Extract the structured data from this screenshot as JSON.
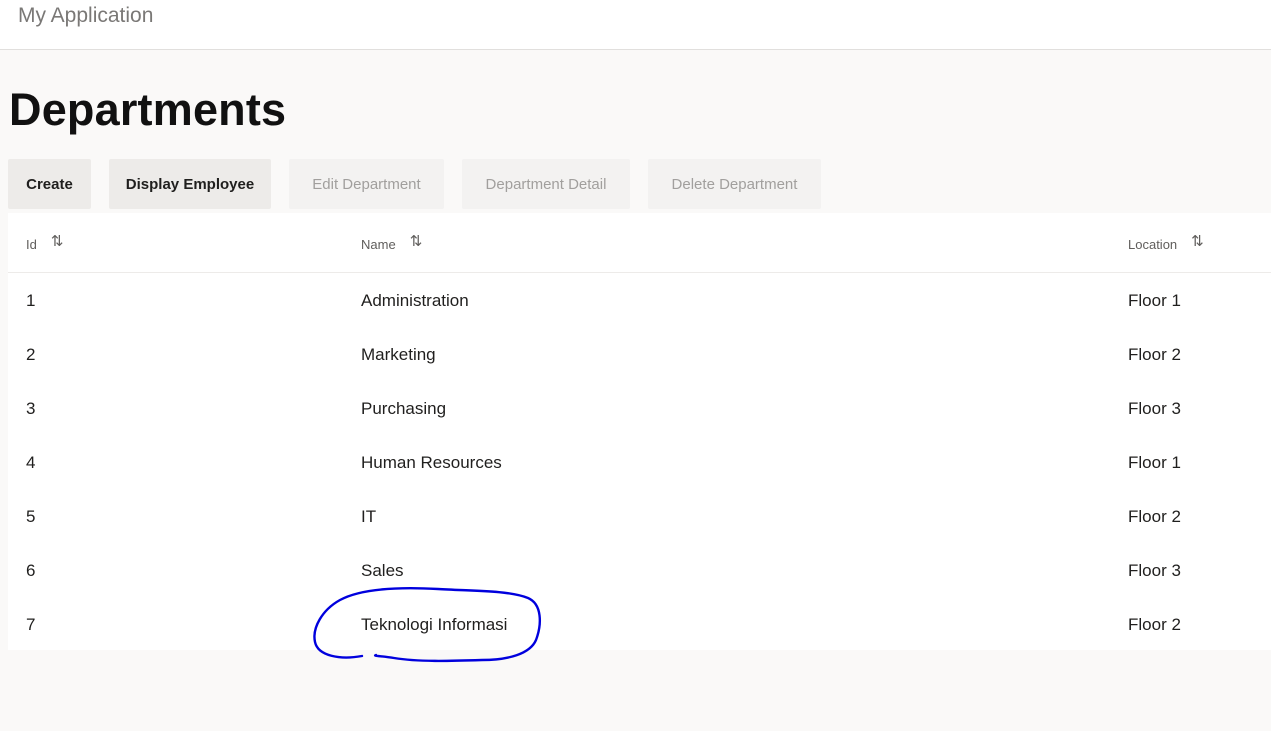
{
  "app": {
    "title": "My Application"
  },
  "page": {
    "title": "Departments"
  },
  "toolbar": {
    "create_label": "Create",
    "display_employee_label": "Display Employee",
    "edit_department_label": "Edit Department",
    "department_detail_label": "Department Detail",
    "delete_department_label": "Delete Department"
  },
  "table": {
    "columns": [
      {
        "label": "Id",
        "sort_icon": "sort-icon"
      },
      {
        "label": "Name",
        "sort_icon": "sort-icon"
      },
      {
        "label": "Location",
        "sort_icon": "sort-icon"
      }
    ],
    "rows": [
      {
        "id": "1",
        "name": "Administration",
        "location": "Floor 1"
      },
      {
        "id": "2",
        "name": "Marketing",
        "location": "Floor 2"
      },
      {
        "id": "3",
        "name": "Purchasing",
        "location": "Floor 3"
      },
      {
        "id": "4",
        "name": "Human Resources",
        "location": "Floor 1"
      },
      {
        "id": "5",
        "name": "IT",
        "location": "Floor 2"
      },
      {
        "id": "6",
        "name": "Sales",
        "location": "Floor 3"
      },
      {
        "id": "7",
        "name": "Teknologi Informasi",
        "location": "Floor 2"
      }
    ]
  },
  "colors": {
    "background": "#faf9f8",
    "surface": "#ffffff",
    "button_bg": "#edebe9",
    "disabled_text": "#a19f9d",
    "annotation": "#0000dd"
  }
}
